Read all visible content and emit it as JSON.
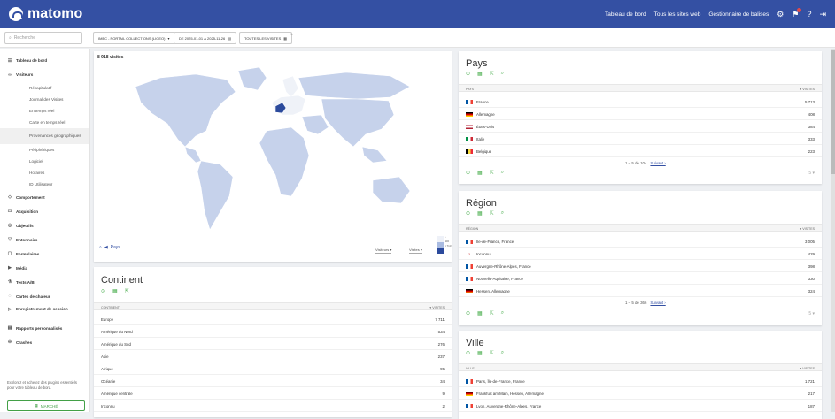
{
  "app": {
    "logo_text": "matomo"
  },
  "topnav": {
    "dashboard": "Tableau de bord",
    "all_sites": "Tous les sites web",
    "tag_manager": "Gestionnaire de balises"
  },
  "subbar": {
    "search_placeholder": "Recherche",
    "site": "IMEC - PORTAIL COLLECTIONS (LIGEO)",
    "period": "DE 2025-01-01 À 2025-11-26",
    "segment": "TOUTES LES VISITES"
  },
  "sidebar": {
    "dashboard": "Tableau de bord",
    "visitors": "Visiteurs",
    "visitor_items": [
      "Récapitulatif",
      "Journal des Visites",
      "En temps réel",
      "Carte en temps réel",
      "Provenances géographiques",
      "Périphériques",
      "Logiciel",
      "Horaires",
      "ID Utilisateur"
    ],
    "sections": [
      "Comportement",
      "Acquisition",
      "Objectifs",
      "Entonnoirs",
      "Formulaires",
      "Média",
      "Tests A/B",
      "Cartes de chaleur",
      "Enregistrement de session",
      "Rapports personnalisés",
      "Crashes"
    ],
    "footer_text": "Explorez et achetez des plugins essentiels pour votre tableau de bord.",
    "market_button": "MARCHÉ"
  },
  "map": {
    "visits_label": "8 918 visites",
    "back_label": "Pays",
    "metric_select": "Visiteurs",
    "scale_select": "Visites",
    "legend_labels": [
      "1",
      "500",
      "5 713"
    ]
  },
  "continent": {
    "title": "Continent",
    "col_label": "CONTINENT",
    "col_value": "VISITES",
    "rows": [
      {
        "label": "Europe",
        "value": "7 711"
      },
      {
        "label": "Amérique du Nord",
        "value": "534"
      },
      {
        "label": "Amérique du Sud",
        "value": "276"
      },
      {
        "label": "Asie",
        "value": "237"
      },
      {
        "label": "Afrique",
        "value": "95"
      },
      {
        "label": "Océanie",
        "value": "34"
      },
      {
        "label": "Amérique centrale",
        "value": "9"
      },
      {
        "label": "Inconnu",
        "value": "2"
      }
    ]
  },
  "pays": {
    "title": "Pays",
    "col_label": "PAYS",
    "col_value": "VISITES",
    "rows": [
      {
        "label": "France",
        "value": "5 713"
      },
      {
        "label": "Allemagne",
        "value": "408"
      },
      {
        "label": "États-Unis",
        "value": "384"
      },
      {
        "label": "Italie",
        "value": "333"
      },
      {
        "label": "Belgique",
        "value": "223"
      }
    ],
    "pager": "1 – 5 de 104",
    "next": "Suivant ›"
  },
  "region": {
    "title": "Région",
    "col_label": "RÉGION",
    "col_value": "VISITES",
    "rows": [
      {
        "label": "Île-de-France, France",
        "value": "3 005"
      },
      {
        "label": "Inconnu",
        "value": "429"
      },
      {
        "label": "Auvergne-Rhône-Alpes, France",
        "value": "398"
      },
      {
        "label": "Nouvelle-Aquitaine, France",
        "value": "330"
      },
      {
        "label": "Hessen, Allemagne",
        "value": "324"
      }
    ],
    "pager": "1 – 5 de 366",
    "next": "Suivant ›"
  },
  "ville": {
    "title": "Ville",
    "col_label": "VILLE",
    "col_value": "VISITES",
    "rows": [
      {
        "label": "Paris, Île-de-France, France",
        "value": "1 721"
      },
      {
        "label": "Frankfurt am Main, Hessen, Allemagne",
        "value": "217"
      },
      {
        "label": "Lyon, Auvergne-Rhône-Alpes, France",
        "value": "187"
      }
    ]
  },
  "footer_limit": "5",
  "colors": {
    "accent": "#3450a3",
    "green": "#4caf50",
    "map_light": "#c6d2eb",
    "map_dark": "#2b4a9c"
  }
}
